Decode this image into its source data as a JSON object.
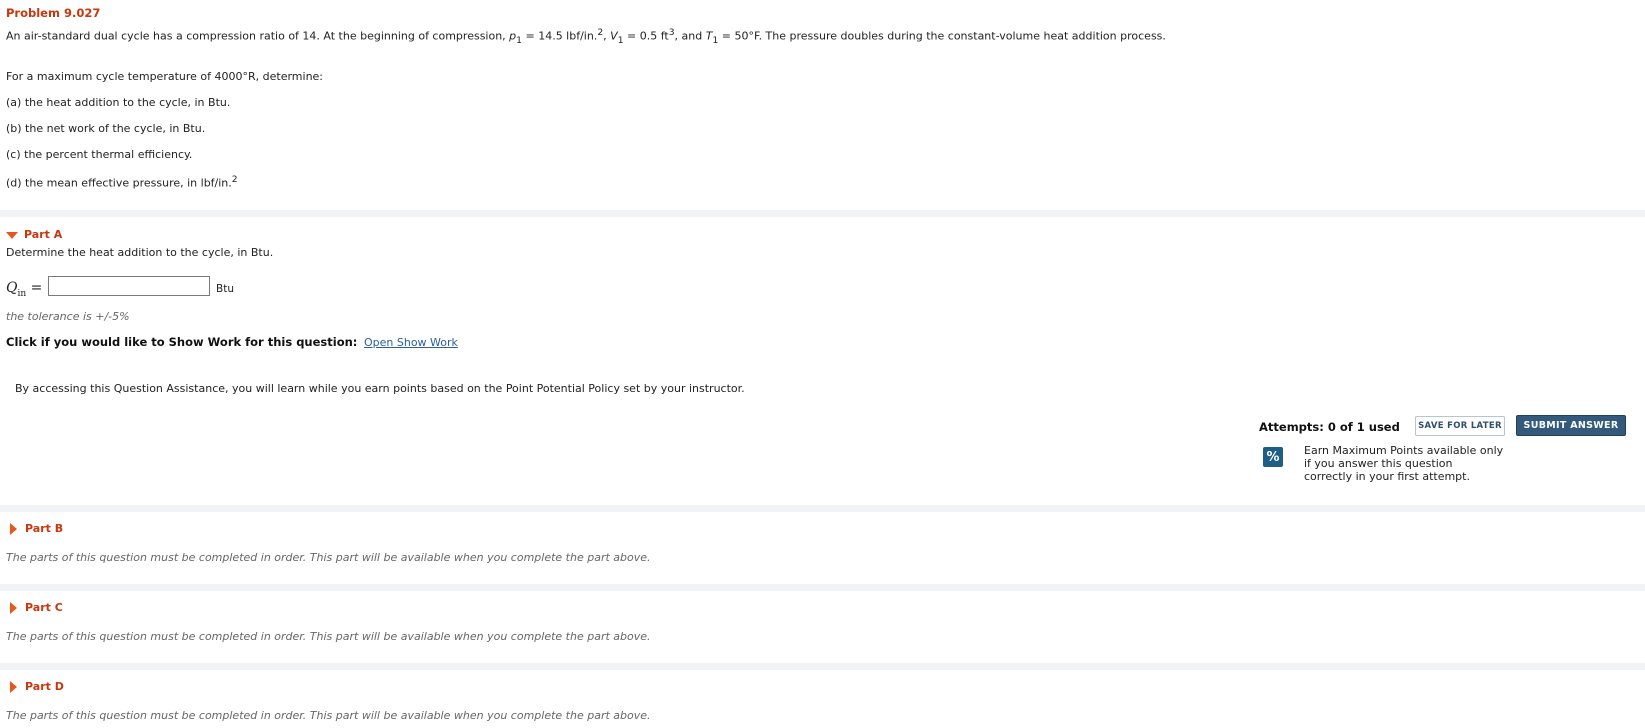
{
  "problem": {
    "title": "Problem 9.027",
    "intro_parts": {
      "a": "An air-standard dual cycle has a compression ratio of 14. At the beginning of compression, ",
      "p1_sym": "p",
      "p1_sub": "1",
      "p1_val": " = 14.5 lbf/in.",
      "p1_sup": "2",
      "v1_pre": ", ",
      "v1_sym": "V",
      "v1_sub": "1",
      "v1_val": " = 0.5 ft",
      "v1_sup": "3",
      "t1_pre": ", and ",
      "t1_sym": "T",
      "t1_sub": "1",
      "t1_val": " = 50°F. The pressure doubles during the constant-volume heat addition process."
    },
    "lead": "For a maximum cycle temperature of 4000°R, determine:",
    "items": [
      "(a) the heat addition to the cycle, in Btu.",
      "(b) the net work of the cycle, in Btu.",
      "(c) the percent thermal efficiency."
    ],
    "item_d": "(d) the mean effective pressure, in lbf/in.",
    "item_d_sup": "2"
  },
  "partA": {
    "label": "Part A",
    "prompt": "Determine the heat addition to the cycle, in Btu.",
    "var_sym": "Q",
    "var_sub": "in",
    "equals": " =",
    "input_value": "",
    "unit": "Btu",
    "tolerance": "the tolerance is +/-5%",
    "showwork_label": "Click if you would like to Show Work for this question:",
    "showwork_link": "Open Show Work",
    "assist": "By accessing this Question Assistance, you will learn while you earn points based on the Point Potential Policy set by your instructor.",
    "attempts": "Attempts: 0 of 1 used",
    "save_button": "SAVE FOR LATER",
    "submit_button": "SUBMIT ANSWER",
    "pct_symbol": "%",
    "earn_text": "Earn Maximum Points available only if you answer this question correctly in your first attempt."
  },
  "locked_parts": [
    {
      "label": "Part B",
      "message": "The parts of this question must be completed in order. This part will be available when you complete the part above."
    },
    {
      "label": "Part C",
      "message": "The parts of this question must be completed in order. This part will be available when you complete the part above."
    },
    {
      "label": "Part D",
      "message": "The parts of this question must be completed in order. This part will be available when you complete the part above."
    }
  ],
  "colors": {
    "accent": "#c8370e",
    "arrow": "#e5581d",
    "submit_bg": "#335a7c",
    "band": "#f1f4f6"
  }
}
